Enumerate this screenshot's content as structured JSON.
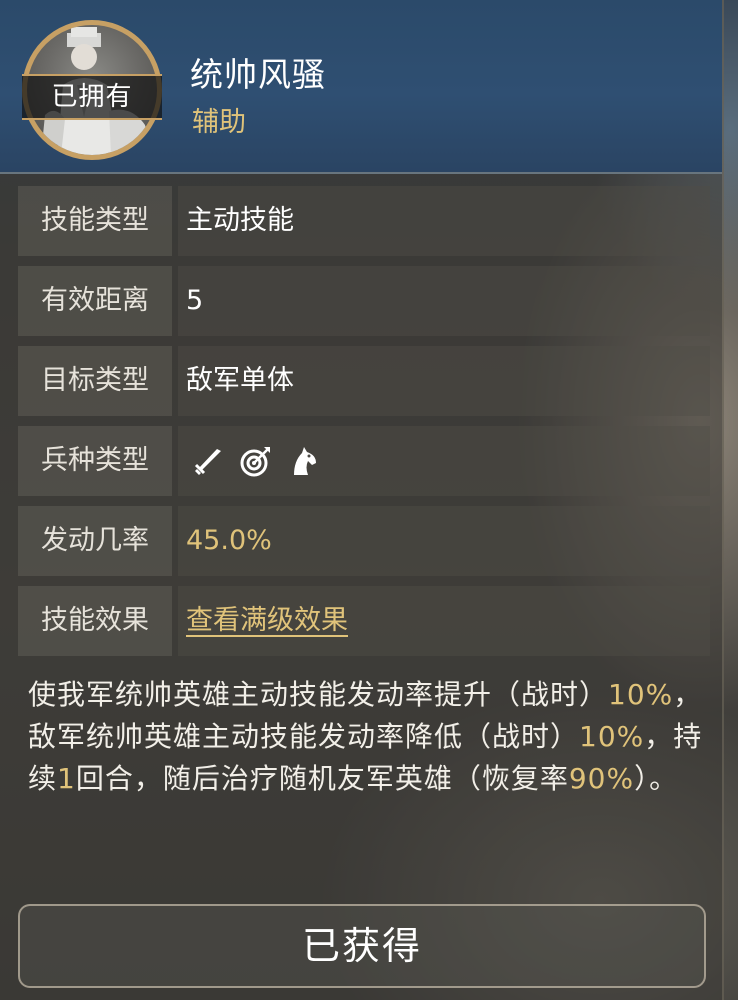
{
  "skill": {
    "name": "统帅风骚",
    "role": "辅助",
    "owned_badge": "已拥有"
  },
  "attributes": {
    "skill_type": {
      "label": "技能类型",
      "value": "主动技能"
    },
    "range": {
      "label": "有效距离",
      "value": "5"
    },
    "target_type": {
      "label": "目标类型",
      "value": "敌军单体"
    },
    "troop_type": {
      "label": "兵种类型",
      "icons": [
        "sword-icon",
        "bow-target-icon",
        "horse-icon"
      ]
    },
    "trigger_rate": {
      "label": "发动几率",
      "value": "45.0%"
    },
    "effect": {
      "label": "技能效果",
      "link": "查看满级效果"
    }
  },
  "description": {
    "p1": "使我军统帅英雄主动技能发动率提升（战时）",
    "v1": "10%",
    "p2": "，敌军统帅英雄主动技能发动率降低（战时）",
    "v2": "10%",
    "p3": "，持续",
    "v3": "1",
    "p4": "回合，随后治疗随机友军英雄（恢复率",
    "v4": "90%",
    "p5": "）。"
  },
  "footer": {
    "button_label": "已获得"
  },
  "colors": {
    "gold": "#e0c37a",
    "header_blue": "#2f4f72",
    "portrait_ring": "#c7a064"
  }
}
